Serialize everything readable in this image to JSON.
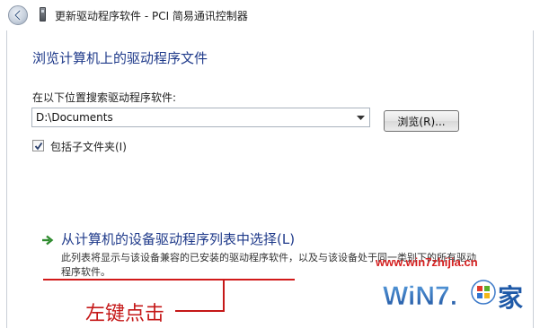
{
  "window": {
    "title": "更新驱动程序软件 - PCI 简易通讯控制器",
    "back_icon": "back-arrow-icon",
    "device_icon": "device-icon"
  },
  "main": {
    "heading": "浏览计算机上的驱动程序文件",
    "search_label": "在以下位置搜索驱动程序软件:",
    "path_value": "D:\\Documents",
    "browse_button": "浏览(R)...",
    "include_subfolders": {
      "label": "包括子文件夹(I)",
      "checked": true
    },
    "pick_link": {
      "title": "从计算机的设备驱动程序列表中选择(L)",
      "description": "此列表将显示与该设备兼容的已安装的驱动程序软件，以及与该设备处于同一类别下的所有驱动程序软件。"
    }
  },
  "annotation": {
    "text": "左键点击",
    "color": "#c51818"
  },
  "watermark": {
    "url": "www.win7zhijia.cn",
    "logo_text": "WiN7.",
    "logo_suffix": "家"
  },
  "colors": {
    "heading_blue": "#1f3a8a",
    "link_green": "#2e8b2e",
    "annotation_red": "#c51818"
  }
}
